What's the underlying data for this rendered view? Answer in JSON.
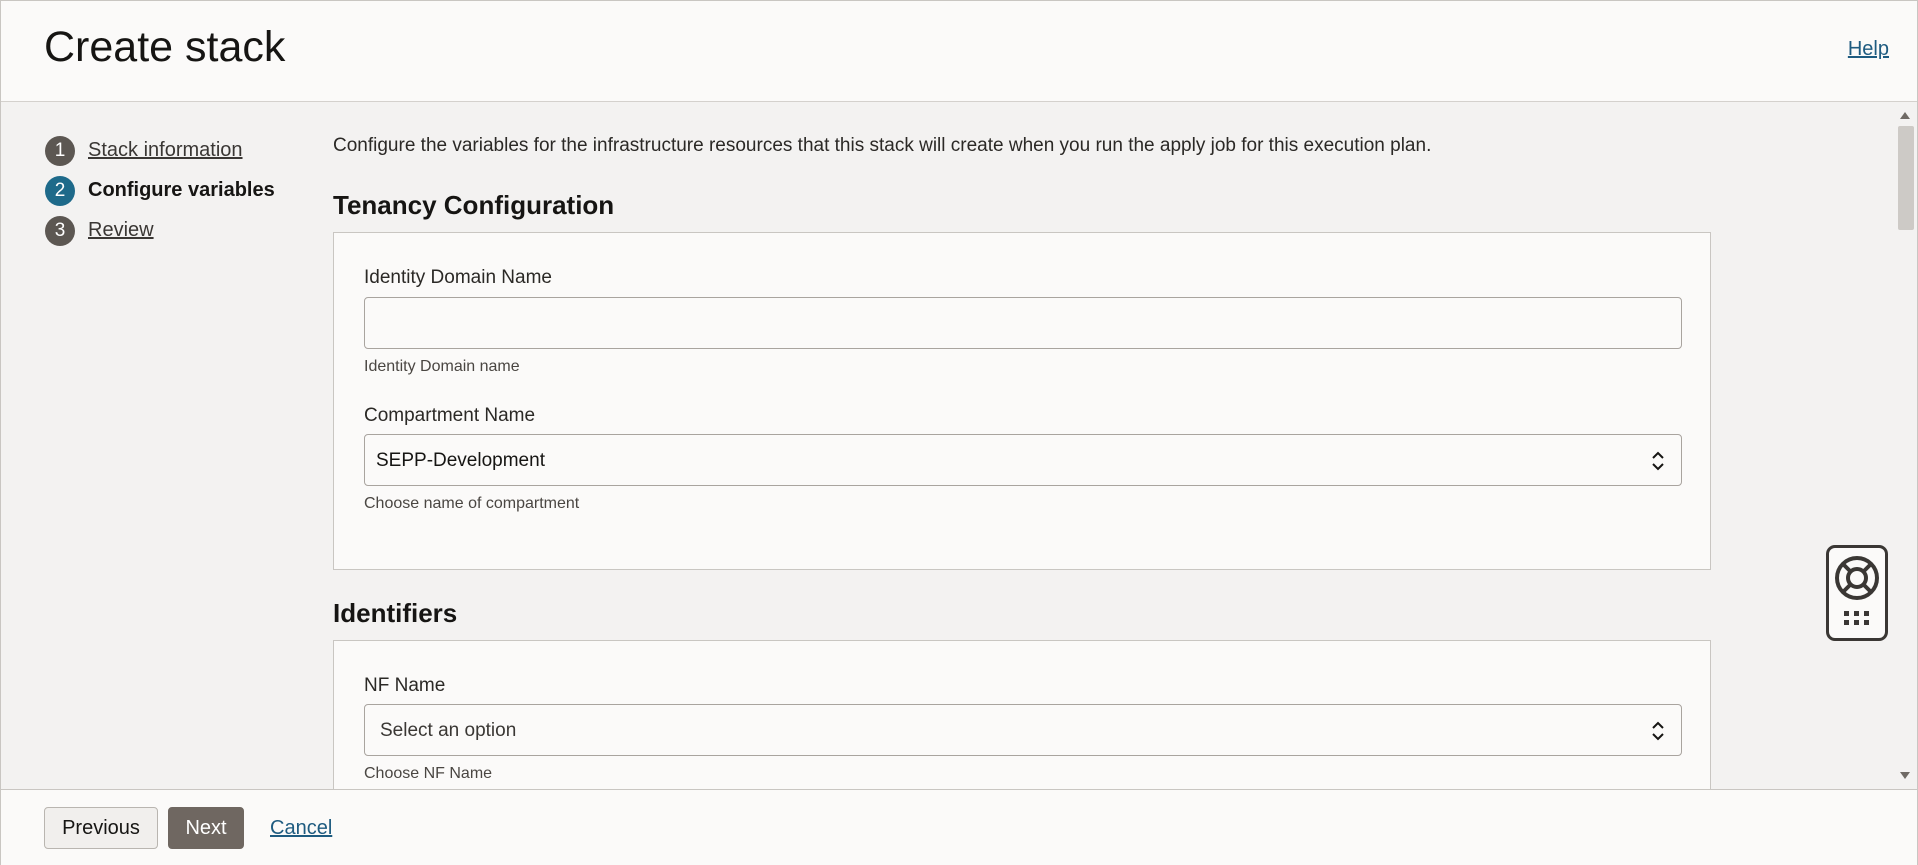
{
  "header": {
    "title": "Create stack",
    "help_label": "Help"
  },
  "steps": [
    {
      "number": "1",
      "label": "Stack information",
      "state": "link"
    },
    {
      "number": "2",
      "label": "Configure variables",
      "state": "current"
    },
    {
      "number": "3",
      "label": "Review",
      "state": "link"
    }
  ],
  "intro": "Configure the variables for the infrastructure resources that this stack will create when you run the apply job for this execution plan.",
  "tenancy": {
    "title": "Tenancy Configuration",
    "identity_domain": {
      "label": "Identity Domain Name",
      "value": "",
      "hint": "Identity Domain name"
    },
    "compartment": {
      "label": "Compartment Name",
      "value": "SEPP-Development",
      "hint": "Choose name of compartment"
    }
  },
  "identifiers": {
    "title": "Identifiers",
    "nf_name": {
      "label": "NF Name",
      "value": "Select an option",
      "hint": "Choose NF Name"
    }
  },
  "footer": {
    "previous_label": "Previous",
    "next_label": "Next",
    "cancel_label": "Cancel"
  },
  "icons": {
    "widget": "lifebuoy-icon",
    "widget_grid": "grid-icon",
    "select": "chevron-up-down-icon"
  }
}
